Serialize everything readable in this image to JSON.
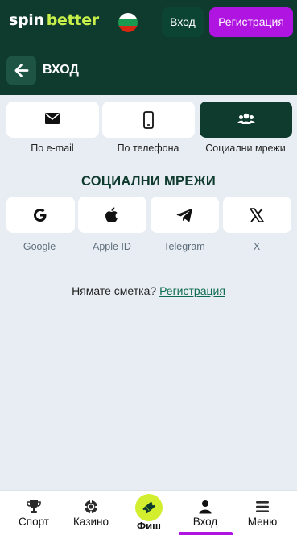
{
  "header": {
    "logo_part1": "spin",
    "logo_part2": "better",
    "flag_colors": [
      "#ffffff",
      "#1a9a50",
      "#d62612"
    ],
    "login_label": "Вход",
    "register_label": "Регистрация"
  },
  "subheader": {
    "back_icon": "arrow-left-icon",
    "title": "ВХОД"
  },
  "methods": [
    {
      "label": "По e-mail",
      "icon": "envelope-icon",
      "active": false
    },
    {
      "label": "По телефона",
      "icon": "phone-icon",
      "active": false
    },
    {
      "label": "Социални мрежи",
      "icon": "users-icon",
      "active": true
    }
  ],
  "social_section": {
    "title": "СОЦИАЛНИ МРЕЖИ",
    "items": [
      {
        "label": "Google",
        "icon": "google-icon"
      },
      {
        "label": "Apple ID",
        "icon": "apple-icon"
      },
      {
        "label": "Telegram",
        "icon": "telegram-icon"
      },
      {
        "label": "X",
        "icon": "x-icon"
      }
    ]
  },
  "no_account": {
    "text": "Нямате сметка?",
    "link": "Регистрация"
  },
  "bottom_nav": [
    {
      "label": "Спорт",
      "icon": "trophy-icon"
    },
    {
      "label": "Казино",
      "icon": "casino-chip-icon"
    },
    {
      "label": "Фиш",
      "icon": "ticket-icon"
    },
    {
      "label": "Вход",
      "icon": "user-icon",
      "active": true
    },
    {
      "label": "Меню",
      "icon": "menu-icon"
    }
  ],
  "colors": {
    "brand_dark": "#0f3b2e",
    "accent_purple": "#b014e0",
    "accent_lime": "#c8f04a",
    "background": "#e8edf3"
  }
}
